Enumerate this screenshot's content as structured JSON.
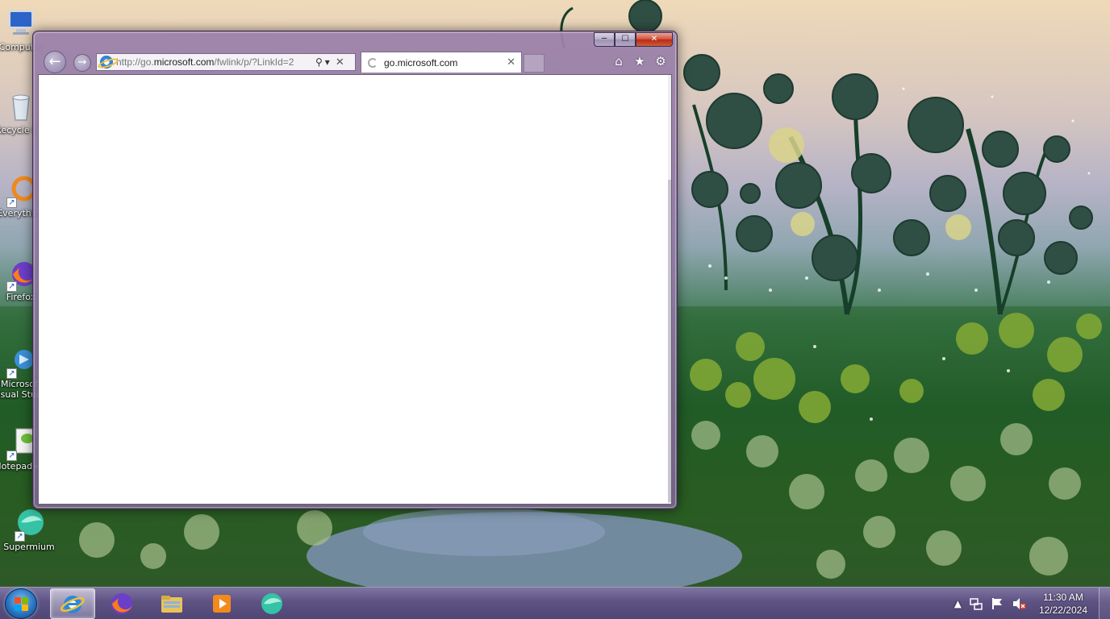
{
  "desktop": {
    "icons": [
      {
        "label": "Computer",
        "icon": "computer-icon"
      },
      {
        "label": "Recycle Bin",
        "icon": "recycle-bin-icon"
      },
      {
        "label": "Everything",
        "icon": "everything-icon"
      },
      {
        "label": "Firefox",
        "icon": "firefox-icon"
      },
      {
        "label": "Microsoft Visual Studio",
        "icon": "visual-studio-icon"
      },
      {
        "label": "Notepad++",
        "icon": "notepad-plus-plus-icon"
      },
      {
        "label": "Supermium",
        "icon": "supermium-icon"
      }
    ]
  },
  "browser": {
    "caption": {
      "minimize": "─",
      "maximize": "☐",
      "close": "✕"
    },
    "nav": {
      "back": "←",
      "forward": "→"
    },
    "address": {
      "url_prefix": "http://go.",
      "url_domain": "microsoft.com",
      "url_suffix": "/fwlink/p/?LinkId=2",
      "search_glyph": "⚲",
      "dropdown_glyph": "▾",
      "stop_glyph": "✕"
    },
    "tab": {
      "title": "go.microsoft.com",
      "close": "✕"
    },
    "tools": {
      "home": "⌂",
      "favorites": "★",
      "settings": "⚙"
    }
  },
  "taskbar": {
    "pinned": [
      {
        "name": "Internet Explorer",
        "icon": "internet-explorer-icon",
        "active": true
      },
      {
        "name": "Firefox",
        "icon": "firefox-icon",
        "active": false
      },
      {
        "name": "Windows Explorer",
        "icon": "folder-icon",
        "active": false
      },
      {
        "name": "Windows Media Player",
        "icon": "media-player-icon",
        "active": false
      },
      {
        "name": "Supermium",
        "icon": "supermium-icon",
        "active": false
      }
    ],
    "tray": {
      "show_hidden": "▲",
      "network": "network-icon",
      "action_center": "flag-icon",
      "volume": "volume-muted-icon"
    },
    "clock": {
      "time": "11:30 AM",
      "date": "12/22/2024"
    }
  },
  "colors": {
    "window_frame": "#9c82aa",
    "close_button": "#c8381f",
    "taskbar": "#5f5287"
  }
}
